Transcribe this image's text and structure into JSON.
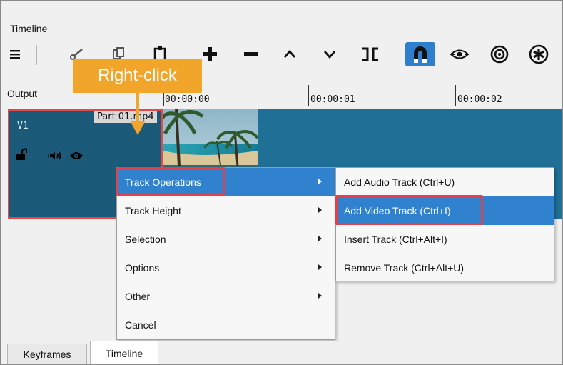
{
  "panel": {
    "title": "Timeline"
  },
  "toolbar": {
    "icons": [
      "menu-icon",
      "cut-icon",
      "copy-icon",
      "paste-icon",
      "add-icon",
      "remove-icon",
      "lift-icon",
      "overwrite-icon",
      "split-icon",
      "snap-magnet-icon",
      "scrub-icon",
      "ripple-icon",
      "ripple-all-icon"
    ],
    "active": "snap-magnet-icon"
  },
  "header": {
    "output_label": "Output",
    "ruler": [
      "00:00:00",
      "00:00:01",
      "00:00:02"
    ]
  },
  "track": {
    "name": "V1"
  },
  "clip": {
    "name": "Part 01.mp4"
  },
  "callout": {
    "text": "Right-click"
  },
  "context_menu": {
    "items": [
      {
        "label": "Track Operations",
        "submenu": true,
        "highlighted": true
      },
      {
        "label": "Track Height",
        "submenu": true
      },
      {
        "label": "Selection",
        "submenu": true
      },
      {
        "label": "Options",
        "submenu": true
      },
      {
        "label": "Other",
        "submenu": true
      },
      {
        "label": "Cancel",
        "submenu": false
      }
    ]
  },
  "submenu": {
    "items": [
      {
        "label": "Add Audio Track (Ctrl+U)"
      },
      {
        "label": "Add Video Track (Ctrl+I)",
        "highlighted": true
      },
      {
        "label": "Insert Track (Ctrl+Alt+I)"
      },
      {
        "label": "Remove Track (Ctrl+Alt+U)"
      }
    ]
  },
  "tabs": [
    {
      "label": "Keyframes",
      "active": false
    },
    {
      "label": "Timeline",
      "active": true
    }
  ],
  "colors": {
    "accent": "#3182ce",
    "highlight_border": "#e2414b",
    "callout": "#f2a52b",
    "track_bg": "#1b5a78",
    "clip_bg": "#1f6f97"
  }
}
